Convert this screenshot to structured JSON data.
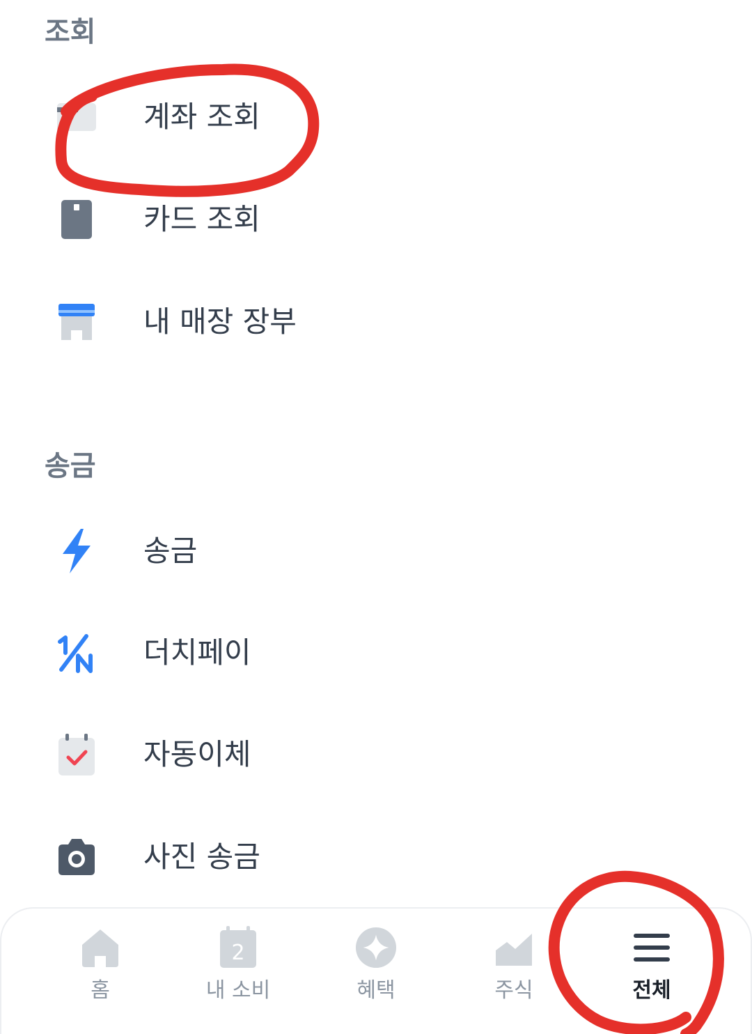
{
  "sections": {
    "inquiry": {
      "title": "조회",
      "items": [
        {
          "label": "계좌 조회",
          "icon": "account-icon"
        },
        {
          "label": "카드 조회",
          "icon": "card-icon"
        },
        {
          "label": "내 매장 장부",
          "icon": "store-icon"
        }
      ]
    },
    "transfer": {
      "title": "송금",
      "items": [
        {
          "label": "송금",
          "icon": "lightning-icon"
        },
        {
          "label": "더치페이",
          "icon": "split-bill-icon"
        },
        {
          "label": "자동이체",
          "icon": "calendar-check-icon"
        },
        {
          "label": "사진 송금",
          "icon": "camera-icon"
        }
      ]
    }
  },
  "bottom_nav": {
    "active": "전체",
    "items": [
      {
        "label": "홈",
        "icon": "home-icon"
      },
      {
        "label": "내 소비",
        "icon": "calendar-icon",
        "badge": "2"
      },
      {
        "label": "혜택",
        "icon": "sparkle-icon"
      },
      {
        "label": "주식",
        "icon": "chart-icon"
      },
      {
        "label": "전체",
        "icon": "menu-icon"
      }
    ]
  },
  "colors": {
    "section_title": "#6b7684",
    "label": "#333d4b",
    "icon_gray": "#6b7684",
    "icon_blue": "#3182f6",
    "icon_red": "#f04452",
    "nav_inactive": "#d1d6db",
    "nav_active": "#333d4b",
    "annotation_red": "#e5302a"
  }
}
